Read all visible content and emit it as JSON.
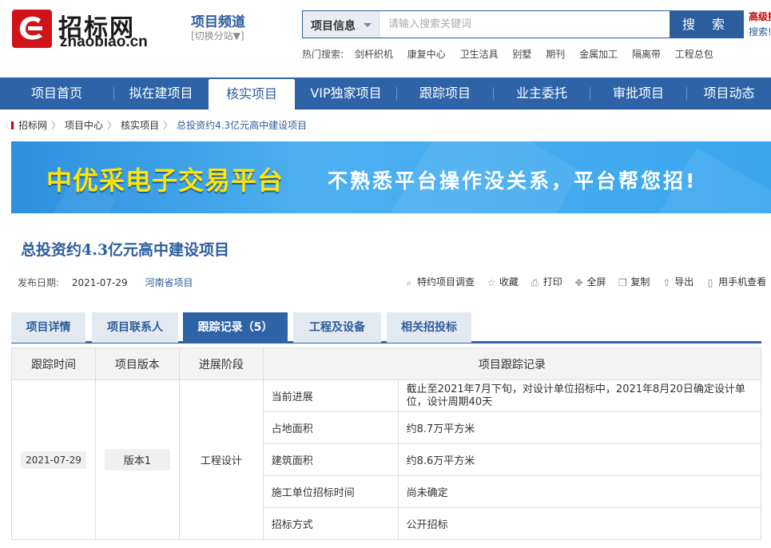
{
  "header": {
    "logo_cn": "招标网",
    "logo_en": "zhaobiao.cn",
    "channel_title": "项目频道",
    "channel_switch": "[切换分站▼]",
    "search_category": "项目信息",
    "search_placeholder": "请输入搜索关键词",
    "search_button": "搜 索",
    "advanced_search": "高级搜",
    "search_more": "搜索!",
    "hot_label": "热门搜索:",
    "hot_items": [
      "剑杆织机",
      "康复中心",
      "卫生洁具",
      "别墅",
      "期刊",
      "金属加工",
      "隔离带",
      "工程总包"
    ]
  },
  "nav": {
    "items": [
      "项目首页",
      "拟在建项目",
      "核实项目",
      "VIP独家项目",
      "跟踪项目",
      "业主委托",
      "审批项目",
      "项目动态"
    ],
    "active_index": 2
  },
  "breadcrumb": {
    "items": [
      "招标网",
      "项目中心",
      "核实项目",
      "总投资约4.3亿元高中建设项目"
    ],
    "separator": "〉"
  },
  "banner": {
    "title": "中优采电子交易平台",
    "subtitle": "不熟悉平台操作没关系，平台帮您招!"
  },
  "project": {
    "title": "总投资约4.3亿元高中建设项目",
    "publish_label": "发布日期:",
    "publish_date": "2021-07-29",
    "region": "河南省项目"
  },
  "tools": [
    {
      "icon": "search-icon",
      "label": "特约项目调查"
    },
    {
      "icon": "star-icon",
      "label": "收藏"
    },
    {
      "icon": "print-icon",
      "label": "打印"
    },
    {
      "icon": "fullscreen-icon",
      "label": "全屏"
    },
    {
      "icon": "copy-icon",
      "label": "复制"
    },
    {
      "icon": "export-icon",
      "label": "导出"
    },
    {
      "icon": "mobile-icon",
      "label": "用手机查看"
    }
  ],
  "tabs": {
    "items": [
      "项目详情",
      "项目联系人",
      "跟踪记录（5）",
      "工程及设备",
      "相关招投标"
    ],
    "active_index": 2
  },
  "table": {
    "headers": [
      "跟踪时间",
      "项目版本",
      "进展阶段",
      "项目跟踪记录"
    ],
    "date": "2021-07-29",
    "version": "版本1",
    "stage": "工程设计",
    "records": [
      {
        "label": "当前进展",
        "value": "截止至2021年7月下旬，对设计单位招标中，2021年8月20日确定设计单位，设计周期40天"
      },
      {
        "label": "占地面积",
        "value": "约8.7万平方米"
      },
      {
        "label": "建筑面积",
        "value": "约8.6万平方米"
      },
      {
        "label": "施工单位招标时间",
        "value": "尚未确定"
      },
      {
        "label": "招标方式",
        "value": "公开招标"
      }
    ]
  },
  "colors": {
    "brand_blue": "#2e63a8",
    "logo_red": "#d0131b",
    "banner_yellow": "#ffe600"
  }
}
